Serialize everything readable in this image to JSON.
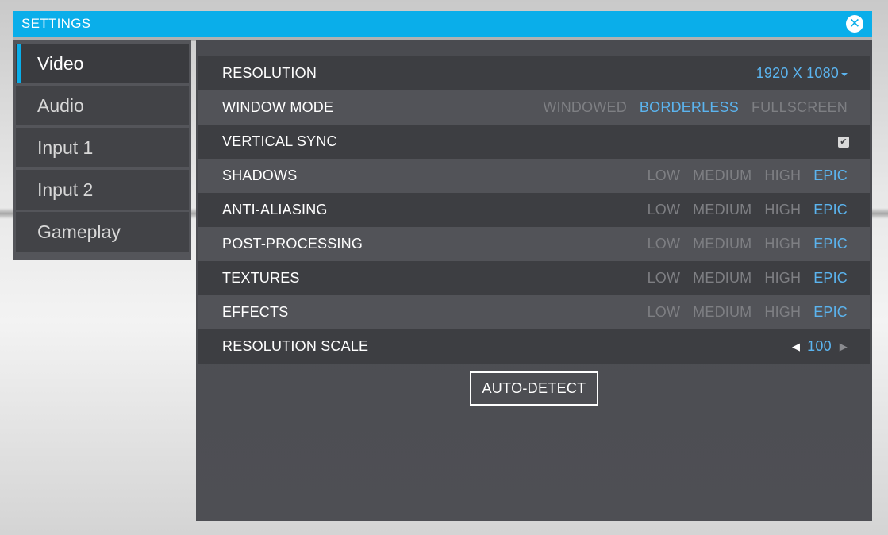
{
  "window": {
    "title": "SETTINGS",
    "close_icon": "✕"
  },
  "sidebar": {
    "items": [
      {
        "label": "Video",
        "active": true
      },
      {
        "label": "Audio",
        "active": false
      },
      {
        "label": "Input 1",
        "active": false
      },
      {
        "label": "Input 2",
        "active": false
      },
      {
        "label": "Gameplay",
        "active": false
      }
    ]
  },
  "video": {
    "resolution": {
      "label": "RESOLUTION",
      "value": "1920 X 1080"
    },
    "window_mode": {
      "label": "WINDOW MODE",
      "options": [
        "WINDOWED",
        "BORDERLESS",
        "FULLSCREEN"
      ],
      "selected": "BORDERLESS"
    },
    "vertical_sync": {
      "label": "VERTICAL SYNC",
      "checked": true,
      "check_glyph": "✔"
    },
    "shadows": {
      "label": "SHADOWS",
      "options": [
        "LOW",
        "MEDIUM",
        "HIGH",
        "EPIC"
      ],
      "selected": "EPIC"
    },
    "anti_aliasing": {
      "label": "ANTI-ALIASING",
      "options": [
        "LOW",
        "MEDIUM",
        "HIGH",
        "EPIC"
      ],
      "selected": "EPIC"
    },
    "post_processing": {
      "label": "POST-PROCESSING",
      "options": [
        "LOW",
        "MEDIUM",
        "HIGH",
        "EPIC"
      ],
      "selected": "EPIC"
    },
    "textures": {
      "label": "TEXTURES",
      "options": [
        "LOW",
        "MEDIUM",
        "HIGH",
        "EPIC"
      ],
      "selected": "EPIC"
    },
    "effects": {
      "label": "EFFECTS",
      "options": [
        "LOW",
        "MEDIUM",
        "HIGH",
        "EPIC"
      ],
      "selected": "EPIC"
    },
    "resolution_scale": {
      "label": "RESOLUTION SCALE",
      "value": "100",
      "left_arrow": "◀",
      "right_arrow": "▶"
    },
    "auto_detect_label": "AUTO-DETECT"
  },
  "colors": {
    "accent": "#0aaeea",
    "selected_option": "#5bb4ef",
    "unselected_option": "#7e7f83"
  }
}
